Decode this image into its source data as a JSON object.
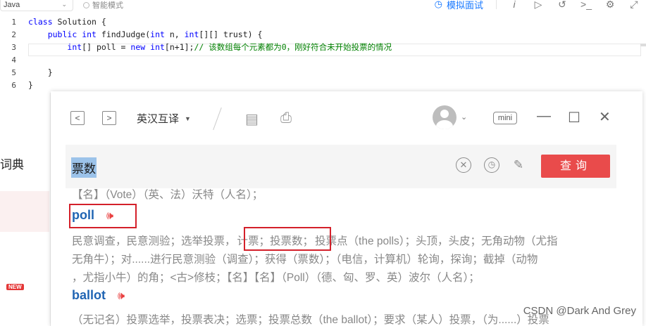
{
  "toolbar": {
    "language": "Java",
    "smart_mode": "智能模式",
    "mock_interview": "模拟面试"
  },
  "code": {
    "lines": [
      {
        "n": "1",
        "indent": "",
        "text": "class Solution {"
      },
      {
        "n": "2",
        "indent": "    ",
        "text": "public int findJudge(int n, int[][] trust) {"
      },
      {
        "n": "3",
        "indent": "        ",
        "text": "int[] poll = new int[n+1];",
        "comment": "// 该数组每个元素都为0，刚好符合未开始投票的情况"
      },
      {
        "n": "4",
        "indent": "",
        "text": ""
      },
      {
        "n": "5",
        "indent": "    ",
        "text": "}"
      },
      {
        "n": "6",
        "indent": "",
        "text": "}"
      }
    ]
  },
  "left_panel": {
    "label": "词典",
    "badge": "NEW"
  },
  "dict": {
    "mode": "英汉互译",
    "mini": "mini",
    "query": "票数",
    "submit": "查询",
    "name_line": "【名】（Vote）（英、法）沃特（人名）；",
    "entries": [
      {
        "word": "poll",
        "def_a": "民意调查，民意测验；选举投票，",
        "def_b": "计票；投票数；",
        "def_c": "投票点（the polls）；头顶，头皮；无角动物（尤指",
        "def_line2": "无角牛）；对......进行民意测验（调查）；获得（票数）；（电信，计算机）轮询，探询；截掉（动物",
        "def_line3": "，尤指小牛）的角；<古>修枝；【名】【名】（Poll）（德、匈、罗、英）波尔（人名）；"
      },
      {
        "word": "ballot",
        "def_line1": "（无记名）投票选举，投票表决；选票；投票总数（the ballot）；要求（某人）投票，（为......）投票"
      }
    ]
  },
  "watermark": "CSDN @Dark And Grey"
}
